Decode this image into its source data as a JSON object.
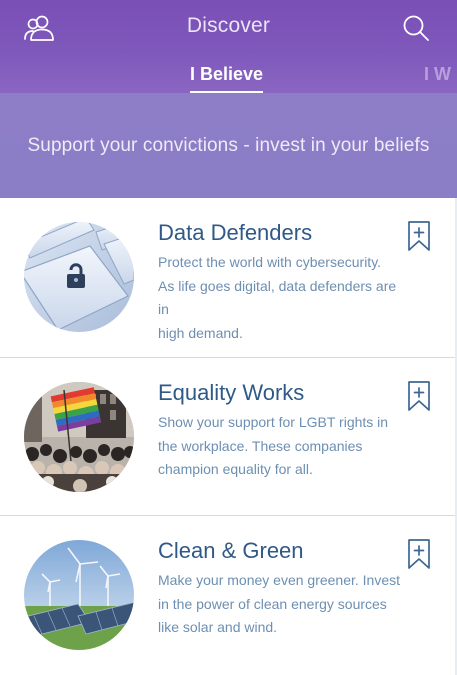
{
  "header": {
    "title": "Discover",
    "icons": {
      "left": "people-icon",
      "right": "search-icon"
    },
    "tabs": [
      {
        "label": "I Believe",
        "active": true
      },
      {
        "label": "I W",
        "active": false
      }
    ]
  },
  "banner": {
    "text": "Support your convictions - invest in your beliefs"
  },
  "themes": [
    {
      "title": "Data Defenders",
      "lines": [
        "Protect the world with cybersecurity.",
        "As life goes digital, data defenders are in",
        "high demand."
      ],
      "icon": "bookmark-add-icon",
      "image": "keyboard-lock-key-image"
    },
    {
      "title": "Equality Works",
      "lines": [
        "Show your support for LGBT rights in",
        "the workplace. These companies",
        "champion equality for all."
      ],
      "icon": "bookmark-add-icon",
      "image": "rainbow-flag-crowd-image"
    },
    {
      "title": "Clean & Green",
      "lines": [
        "Make your money even greener. Invest",
        "in the power of clean energy sources",
        "like solar and wind."
      ],
      "icon": "bookmark-add-icon",
      "image": "wind-turbines-solar-panels-image"
    }
  ],
  "colors": {
    "header": "#7f58bb",
    "banner": "#8c7ec6",
    "card_title": "#2f5a88",
    "card_text": "#6d8fb2",
    "bookmark": "#3d6792"
  }
}
